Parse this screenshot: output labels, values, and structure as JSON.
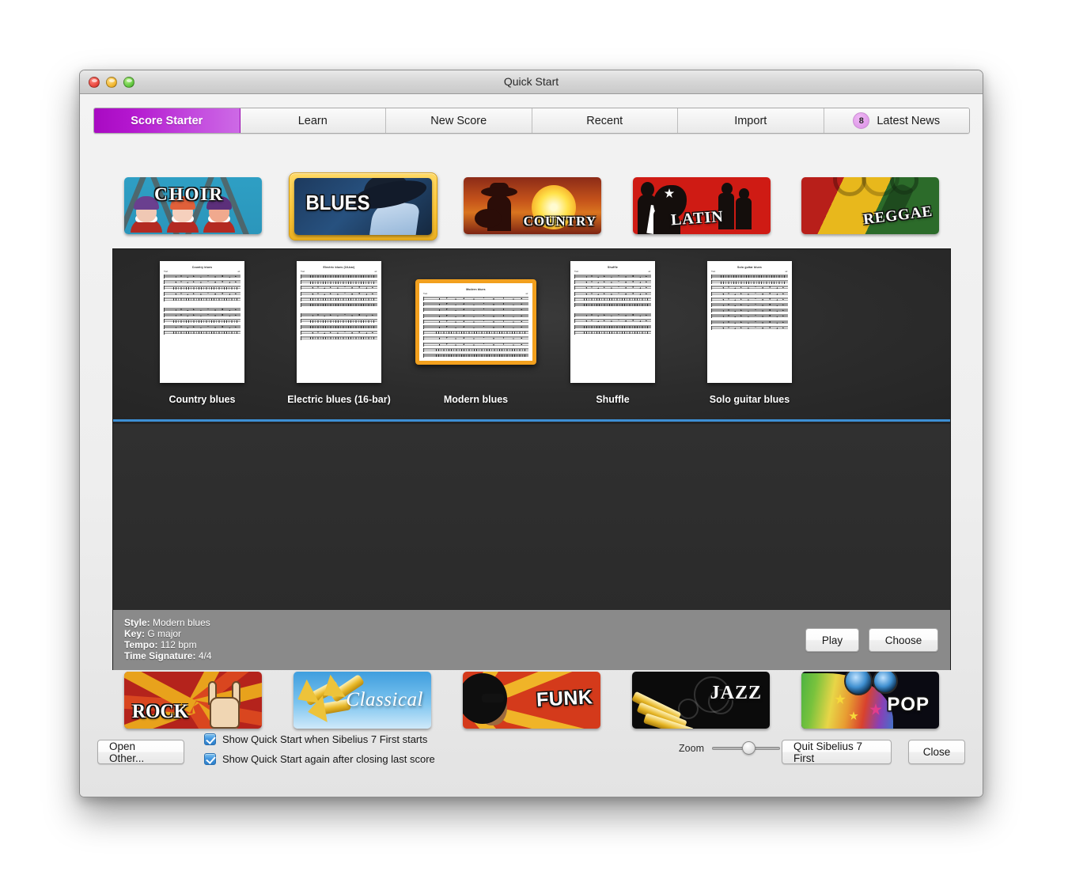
{
  "window": {
    "title": "Quick Start",
    "traffic_lights": [
      "close-red",
      "minimize-yellow",
      "zoom-green"
    ]
  },
  "tabs": [
    {
      "label": "Score Starter",
      "active": true
    },
    {
      "label": "Learn",
      "active": false
    },
    {
      "label": "New Score",
      "active": false
    },
    {
      "label": "Recent",
      "active": false
    },
    {
      "label": "Import",
      "active": false
    },
    {
      "label": "Latest News",
      "active": false,
      "badge": "8"
    }
  ],
  "genres_top": [
    {
      "label": "CHOIR",
      "selected": false
    },
    {
      "label": "BLUES",
      "selected": true
    },
    {
      "label": "COUNTRY",
      "selected": false
    },
    {
      "label": "LATIN",
      "selected": false
    },
    {
      "label": "REGGAE",
      "selected": false
    }
  ],
  "genres_bottom": [
    {
      "label": "ROCK",
      "selected": false
    },
    {
      "label": "Classical",
      "selected": false
    },
    {
      "label": "FUNK",
      "selected": false
    },
    {
      "label": "JAZZ",
      "selected": false
    },
    {
      "label": "POP",
      "selected": false
    }
  ],
  "scores": [
    {
      "label": "Country blues",
      "sheet_title": "Country blues",
      "orientation": "portrait",
      "selected": false
    },
    {
      "label": "Electric blues (16-bar)",
      "sheet_title": "Electric blues (16-bar)",
      "orientation": "portrait",
      "selected": false
    },
    {
      "label": "Modern blues",
      "sheet_title": "Modern blues",
      "orientation": "landscape",
      "selected": true
    },
    {
      "label": "Shuffle",
      "sheet_title": "Shuffle",
      "orientation": "portrait",
      "selected": false
    },
    {
      "label": "Solo guitar blues",
      "sheet_title": "Solo guitar blues",
      "orientation": "portrait",
      "selected": false
    }
  ],
  "info": {
    "style_label": "Style:",
    "style_value": "Modern blues",
    "key_label": "Key:",
    "key_value": "G major",
    "tempo_label": "Tempo:",
    "tempo_value": "112 bpm",
    "timesig_label": "Time Signature:",
    "timesig_value": "4/4"
  },
  "buttons": {
    "play": "Play",
    "choose": "Choose",
    "open_other": "Open Other...",
    "quit": "Quit Sibelius 7 First",
    "close": "Close"
  },
  "options": {
    "show_on_start": "Show Quick Start when Sibelius 7 First starts",
    "show_after_close": "Show Quick Start again after closing last score",
    "show_on_start_checked": true,
    "show_after_close_checked": true
  },
  "zoom": {
    "label": "Zoom",
    "value": 44
  },
  "colors": {
    "active_tab_purple": "#b417cf",
    "selection_orange": "#f2a01e",
    "separator_blue": "#3d8fd4",
    "gallery_dark": "#2c2c2c",
    "infobar_gray": "#8a8a8a"
  }
}
